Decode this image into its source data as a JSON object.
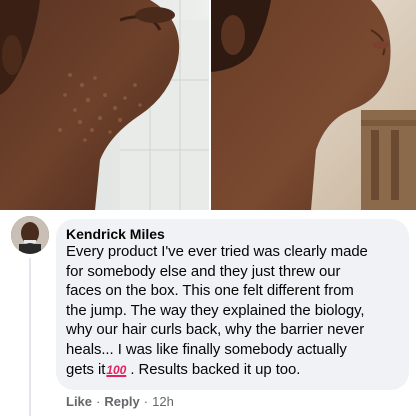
{
  "photos": {
    "left": {
      "description_icon": "before-photo"
    },
    "right": {
      "description_icon": "after-photo"
    }
  },
  "comment": {
    "author": "Kendrick Miles",
    "lines": [
      "Every product I've ever tried was clearly made",
      "for somebody else and they just threw our",
      "faces on the box. This one felt different from",
      "the jump. The way they explained the biology,",
      "why our hair curls back, why the barrier never",
      "heals... I was like finally somebody actually",
      "gets it"
    ],
    "emoji": "100",
    "after_emoji": " . Results backed it up too.",
    "actions": {
      "like": "Like",
      "reply": "Reply",
      "time": "12h"
    }
  },
  "colors": {
    "bubble": "#f0f2f5",
    "meta_text": "#65676b",
    "emoji": "#e0245e"
  }
}
